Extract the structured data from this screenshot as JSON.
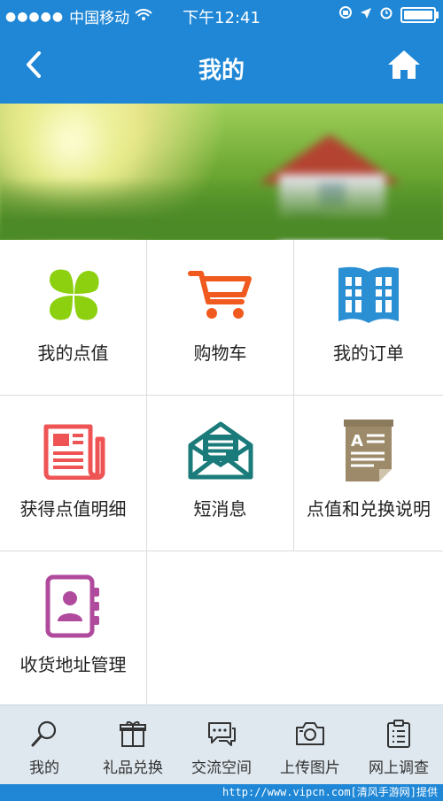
{
  "status_bar": {
    "carrier": "中国移动",
    "time": "下午12:41"
  },
  "navbar": {
    "title": "我的",
    "icons": {
      "back": "back-chevron-icon",
      "home": "home-icon"
    }
  },
  "grid_items": [
    {
      "label": "我的点值",
      "icon": "clover-icon",
      "color": "#8cd00f"
    },
    {
      "label": "购物车",
      "icon": "shopping-cart-icon",
      "color": "#f05a1e"
    },
    {
      "label": "我的订单",
      "icon": "open-book-icon",
      "color": "#2b8fd3"
    },
    {
      "label": "获得点值明细",
      "icon": "newspaper-icon",
      "color": "#ef5454"
    },
    {
      "label": "短消息",
      "icon": "envelope-icon",
      "color": "#1b7b7a"
    },
    {
      "label": "点值和兑换说明",
      "icon": "document-icon",
      "color": "#9d8a6a"
    },
    {
      "label": "收货地址管理",
      "icon": "address-book-icon",
      "color": "#b04a9d"
    }
  ],
  "tabbar": [
    {
      "label": "我的",
      "icon": "search-icon"
    },
    {
      "label": "礼品兑换",
      "icon": "gift-icon"
    },
    {
      "label": "交流空间",
      "icon": "chat-icon"
    },
    {
      "label": "上传图片",
      "icon": "camera-icon"
    },
    {
      "label": "网上调查",
      "icon": "clipboard-icon"
    }
  ],
  "watermark": "http://www.vipcn.com[清风手游网]提供",
  "colors": {
    "primary": "#1f87d6",
    "tabbar_bg": "#dfe8ef"
  }
}
